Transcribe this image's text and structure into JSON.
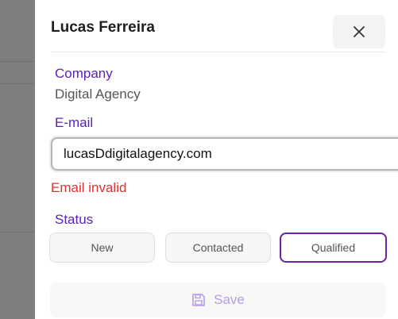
{
  "drawer": {
    "title": "Lucas Ferreira",
    "close_icon": "close-icon",
    "company": {
      "label": "Company",
      "value": "Digital Agency"
    },
    "email": {
      "label": "E-mail",
      "value": "lucasDdigitalagency.com",
      "error": "Email invalid"
    },
    "status": {
      "label": "Status",
      "options": [
        "New",
        "Contacted",
        "Qualified"
      ],
      "selected": "Qualified"
    },
    "save": {
      "label": "Save",
      "icon": "floppy-disk-icon"
    }
  },
  "colors": {
    "accent": "#5b21b6",
    "selected_border": "#6b21a8",
    "error": "#e03131",
    "save_disabled": "#b79be6"
  }
}
